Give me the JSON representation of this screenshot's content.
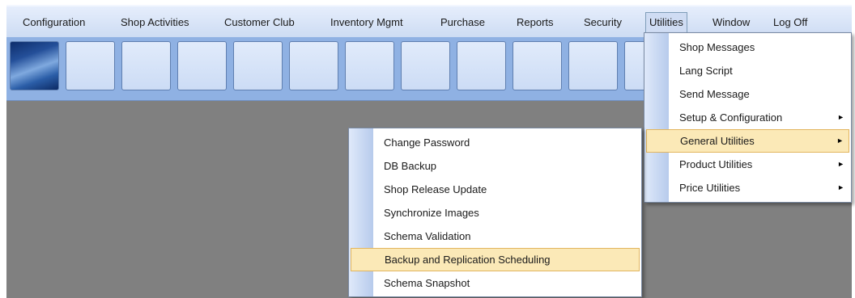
{
  "menubar": {
    "items": [
      {
        "label": "Configuration"
      },
      {
        "label": "Shop Activities"
      },
      {
        "label": "Customer Club"
      },
      {
        "label": "Inventory Mgmt"
      },
      {
        "label": "Purchase"
      },
      {
        "label": "Reports"
      },
      {
        "label": "Security"
      },
      {
        "label": "Utilities"
      },
      {
        "label": "Window"
      },
      {
        "label": "Log Off"
      }
    ]
  },
  "utilities_menu": {
    "items": [
      {
        "label": "Shop Messages"
      },
      {
        "label": "Lang Script"
      },
      {
        "label": "Send Message"
      },
      {
        "label": "Setup & Configuration",
        "arrow": "►"
      },
      {
        "label": "General Utilities",
        "arrow": "►"
      },
      {
        "label": "Product Utilities",
        "arrow": "►"
      },
      {
        "label": "Price Utilities",
        "arrow": "►"
      }
    ]
  },
  "general_utilities_submenu": {
    "items": [
      {
        "label": "Change Password"
      },
      {
        "label": "DB Backup"
      },
      {
        "label": "Shop Release Update"
      },
      {
        "label": "Synchronize Images"
      },
      {
        "label": "Schema Validation"
      },
      {
        "label": "Backup and Replication Scheduling"
      },
      {
        "label": "Schema Snapshot"
      }
    ]
  },
  "colors": {
    "menubar": "#dce7f8",
    "toolbar": "#8fb1e3",
    "workspace": "#808080",
    "menu_highlight": "#fbe9b7",
    "menu_highlight_border": "#e2b55e"
  }
}
